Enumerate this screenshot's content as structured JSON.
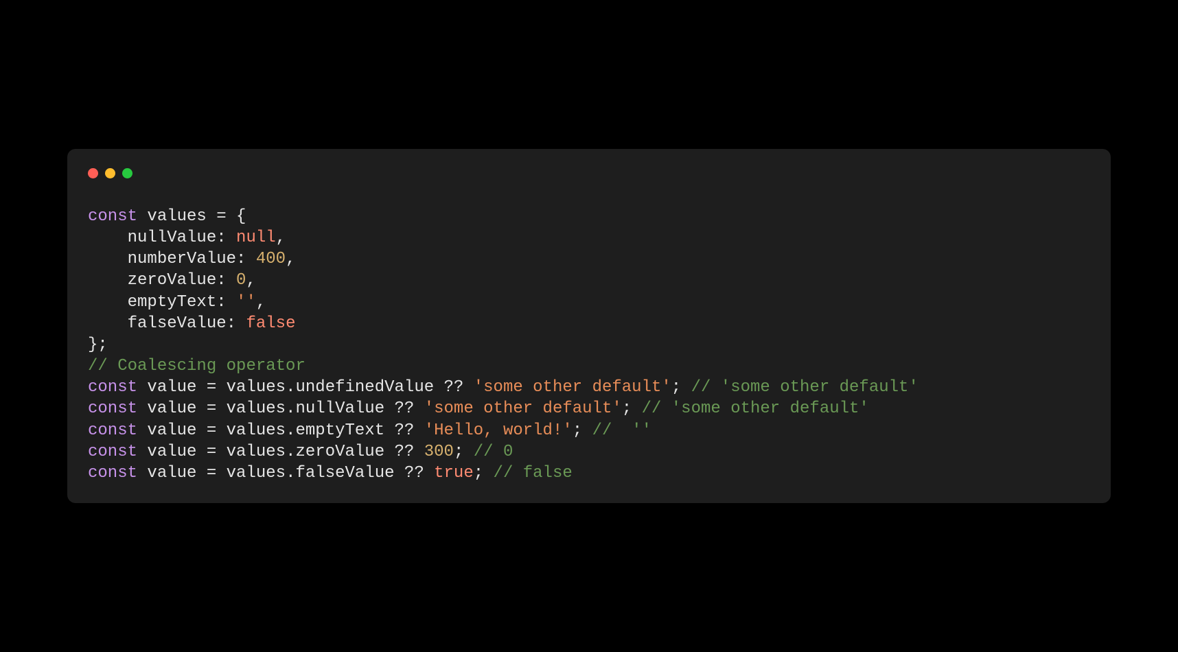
{
  "colors": {
    "bg": "#000000",
    "windowBg": "#1e1e1e",
    "dotRed": "#ff5f56",
    "dotYellow": "#ffbd2e",
    "dotGreen": "#27c93f",
    "keyword": "#c792ea",
    "text": "#e6e6e6",
    "null": "#ff8b72",
    "number": "#d7b16e",
    "string": "#e88d58",
    "comment": "#6a9955",
    "ident": "#9cdcfe"
  },
  "code": {
    "l1": {
      "kw": "const",
      "var": "values",
      "eq": " = {",
      "end": ""
    },
    "l2": {
      "indent": "    ",
      "prop": "nullValue",
      "colon": ": ",
      "val": "null",
      "comma": ","
    },
    "l3": {
      "indent": "    ",
      "prop": "numberValue",
      "colon": ": ",
      "val": "400",
      "comma": ","
    },
    "l4": {
      "indent": "    ",
      "prop": "zeroValue",
      "colon": ": ",
      "val": "0",
      "comma": ","
    },
    "l5": {
      "indent": "    ",
      "prop": "emptyText",
      "colon": ": ",
      "val": "''",
      "comma": ","
    },
    "l6": {
      "indent": "    ",
      "prop": "falseValue",
      "colon": ": ",
      "val": "false",
      "comma": ""
    },
    "l7": {
      "text": ""
    },
    "l8": {
      "text": "};"
    },
    "l9": {
      "text": ""
    },
    "l10": {
      "comment": "// Coalescing operator"
    },
    "l11": {
      "text": ""
    },
    "l12": {
      "kw": "const",
      "var": "value",
      "eq": " = ",
      "obj": "values",
      "dot": ".",
      "prop": "undefinedValue",
      "op": " ?? ",
      "val": "'some other default'",
      "semi": ";",
      "comment": " // 'some other default'"
    },
    "l13": {
      "kw": "const",
      "var": "value",
      "eq": " = ",
      "obj": "values",
      "dot": ".",
      "prop": "nullValue",
      "op": " ?? ",
      "val": "'some other default'",
      "semi": ";",
      "comment": " // 'some other default'"
    },
    "l14": {
      "kw": "const",
      "var": "value",
      "eq": " = ",
      "obj": "values",
      "dot": ".",
      "prop": "emptyText",
      "op": " ?? ",
      "val": "'Hello, world!'",
      "semi": ";",
      "comment": " //  ''"
    },
    "l15": {
      "kw": "const",
      "var": "value",
      "eq": " = ",
      "obj": "values",
      "dot": ".",
      "prop": "zeroValue",
      "op": " ?? ",
      "val": "300",
      "semi": ";",
      "comment": " // 0"
    },
    "l16": {
      "kw": "const",
      "var": "value",
      "eq": " = ",
      "obj": "values",
      "dot": ".",
      "prop": "falseValue",
      "op": " ?? ",
      "val": "true",
      "semi": ";",
      "comment": " // false"
    }
  }
}
